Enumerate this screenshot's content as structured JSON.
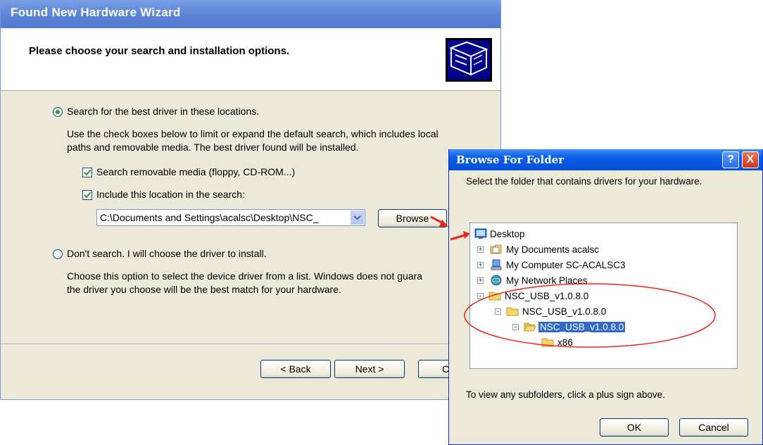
{
  "wizard": {
    "title": "Found New Hardware Wizard",
    "heading": "Please choose your search and installation options.",
    "option_search": {
      "label": "Search for the best driver in these locations.",
      "selected": true,
      "description_line1": "Use the check boxes below to limit or expand the default search, which includes local",
      "description_line2": "paths and removable media. The best driver found will be installed."
    },
    "check_removable": {
      "label": "Search removable media (floppy, CD-ROM...)",
      "checked": true
    },
    "check_location": {
      "label": "Include this location in the search:",
      "checked": true
    },
    "location_value": "C:\\Documents and Settings\\acalsc\\Desktop\\NSC_",
    "browse_label": "Browse",
    "option_dont_search": {
      "label": "Don't search. I will choose the driver to install.",
      "selected": false,
      "description_line1": "Choose this option to select the device driver from a list.  Windows does not guara",
      "description_line2": "the driver you choose will be the best match for your hardware."
    },
    "back_label": "< Back",
    "next_label": "Next >",
    "cancel_label": "Ca"
  },
  "browse_dialog": {
    "title": "Browse For Folder",
    "help_label": "?",
    "close_label": "X",
    "instruction": "Select the folder that contains drivers for your hardware.",
    "tree": [
      {
        "label": "Desktop",
        "icon": "desktop-icon"
      },
      {
        "label": "My Documents acalsc",
        "icon": "documents-icon",
        "expander": "+"
      },
      {
        "label": "My Computer SC-ACALSC3",
        "icon": "computer-icon",
        "expander": "+"
      },
      {
        "label": "My Network Places",
        "icon": "network-icon",
        "expander": "+"
      },
      {
        "label": "NSC_USB_v1.0.8.0",
        "icon": "folder-icon",
        "expander": "-"
      },
      {
        "label": "NSC_USB_v1.0.8.0",
        "icon": "folder-icon",
        "expander": "-"
      },
      {
        "label": "NSC_USB_v1.0.8.0",
        "icon": "folder-open-icon",
        "expander": "-",
        "selected": true
      },
      {
        "label": "x86",
        "icon": "folder-icon"
      }
    ],
    "footer": "To view any subfolders, click a plus sign above.",
    "ok_label": "OK",
    "cancel_label": "Cancel"
  },
  "annotation_colors": {
    "arrow": "#e8281e",
    "ellipse": "#e8281e"
  }
}
